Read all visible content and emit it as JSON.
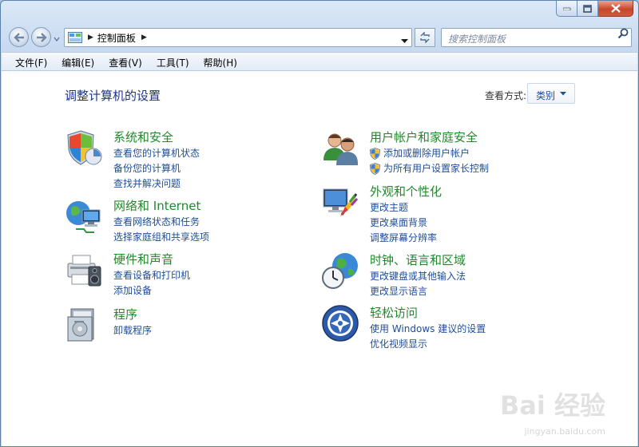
{
  "window": {
    "caption_buttons": [
      "minimize",
      "maximize",
      "close"
    ]
  },
  "address_bar": {
    "icon": "control-panel-icon",
    "path": "控制面板"
  },
  "search": {
    "placeholder": "搜索控制面板"
  },
  "menu": [
    "文件(F)",
    "编辑(E)",
    "查看(V)",
    "工具(T)",
    "帮助(H)"
  ],
  "page": {
    "title": "调整计算机的设置",
    "view_by_label": "查看方式:",
    "view_by_value": "类别"
  },
  "categories": [
    {
      "title": "系统和安全",
      "icon": "shield-system-icon",
      "links": [
        "查看您的计算机状态",
        "备份您的计算机",
        "查找并解决问题"
      ]
    },
    {
      "title": "网络和 Internet",
      "icon": "network-globe-icon",
      "links": [
        "查看网络状态和任务",
        "选择家庭组和共享选项"
      ]
    },
    {
      "title": "硬件和声音",
      "icon": "printer-speaker-icon",
      "links": [
        "查看设备和打印机",
        "添加设备"
      ]
    },
    {
      "title": "程序",
      "icon": "programs-icon",
      "links": [
        "卸载程序"
      ]
    },
    {
      "title": "用户帐户和家庭安全",
      "icon": "users-icon",
      "links": [
        "添加或删除用户帐户",
        "为所有用户设置家长控制"
      ]
    },
    {
      "title": "外观和个性化",
      "icon": "monitor-palette-icon",
      "links": [
        "更改主题",
        "更改桌面背景",
        "调整屏幕分辨率"
      ]
    },
    {
      "title": "时钟、语言和区域",
      "icon": "clock-globe-icon",
      "links": [
        "更改键盘或其他输入法",
        "更改显示语言"
      ]
    },
    {
      "title": "轻松访问",
      "icon": "ease-of-access-icon",
      "links": [
        "使用 Windows 建议的设置",
        "优化视频显示"
      ]
    }
  ],
  "watermark": {
    "main": "Bai 经验",
    "sub": "jingyan.baidu.com"
  }
}
